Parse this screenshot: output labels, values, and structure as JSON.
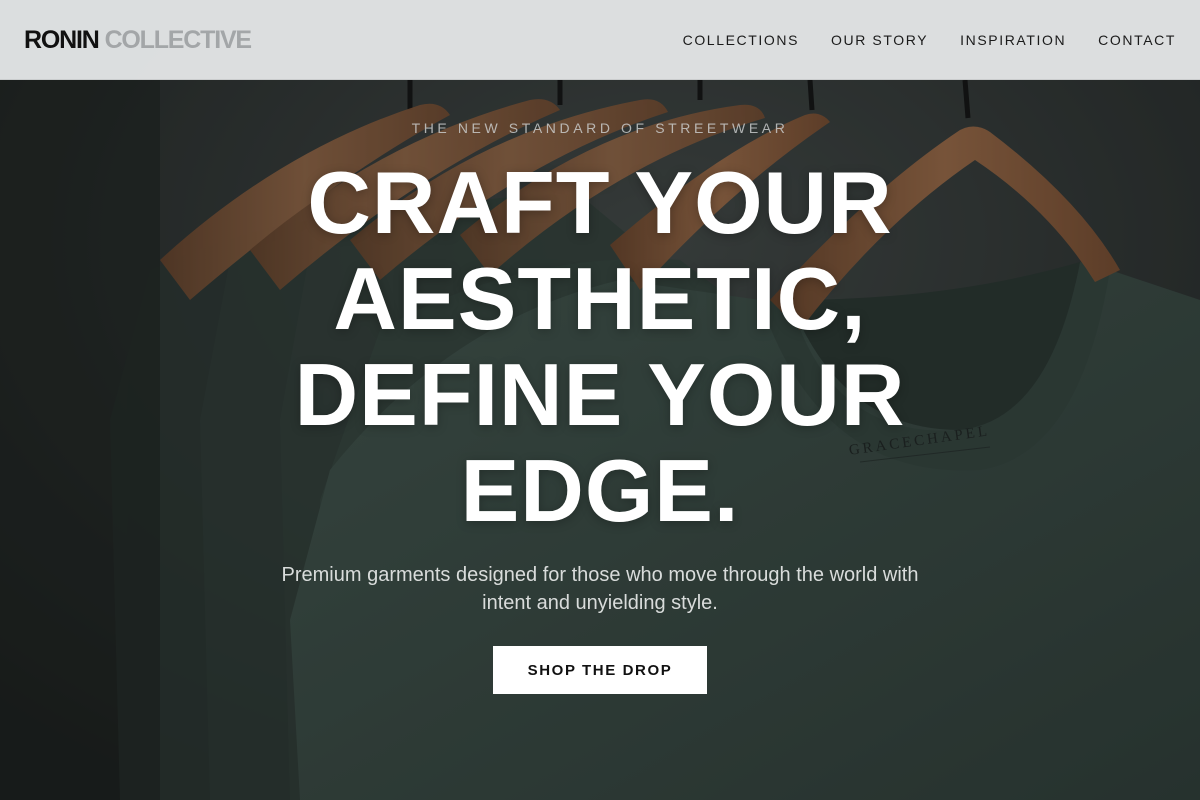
{
  "brand": {
    "primary": "RONIN",
    "secondary": "COLLECTIVE"
  },
  "nav": {
    "items": [
      {
        "label": "COLLECTIONS"
      },
      {
        "label": "OUR STORY"
      },
      {
        "label": "INSPIRATION"
      },
      {
        "label": "CONTACT"
      }
    ]
  },
  "hero": {
    "eyebrow": "THE NEW STANDARD OF STREETWEAR",
    "headline_lines": [
      "CRAFT YOUR",
      "AESTHETIC,",
      "DEFINE YOUR",
      "EDGE."
    ],
    "subtext": "Premium garments designed for those who move through the world with intent and unyielding style.",
    "cta_label": "SHOP THE DROP",
    "background_image": "tshirts-on-hangers-photo",
    "shirt_label_text": "GRACECHAPEL"
  },
  "colors": {
    "header_bg": "#e2e4e5",
    "logo_primary": "#111111",
    "logo_secondary": "#a3a6a8",
    "shirt_green": "#3c4f48",
    "hanger_wood": "#a56c45",
    "cta_bg": "#ffffff",
    "cta_text": "#111111"
  }
}
